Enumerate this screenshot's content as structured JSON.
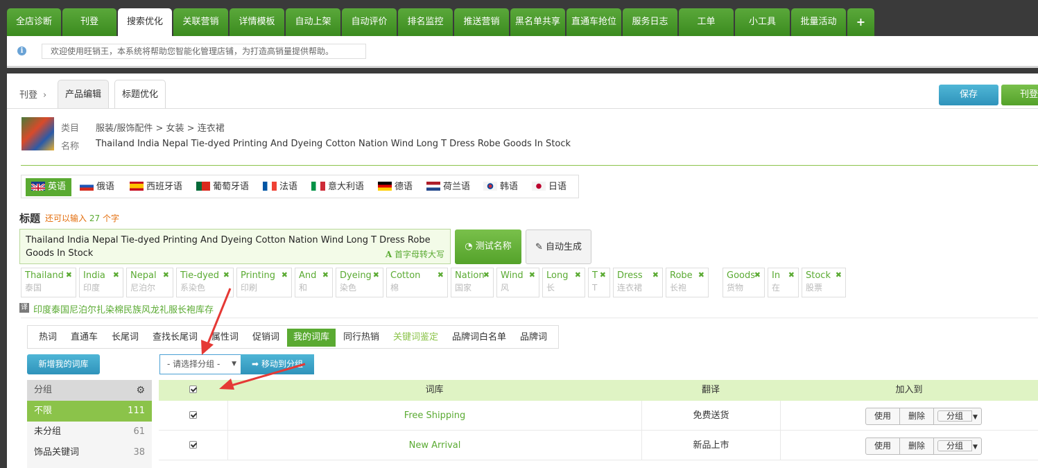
{
  "top_nav": {
    "tabs": [
      "全店诊断",
      "刊登",
      "搜索优化",
      "关联营销",
      "详情模板",
      "自动上架",
      "自动评价",
      "排名监控",
      "推送营销",
      "黑名单共享",
      "直通车抢位",
      "服务日志",
      "工单",
      "小工具",
      "批量活动",
      "+"
    ],
    "active": "搜索优化"
  },
  "notice": {
    "text": "欢迎使用旺销王，本系统将帮助您智能化管理店铺，为打造高销量提供帮助。"
  },
  "breadcrumb": {
    "root": "刊登",
    "chevron": "›"
  },
  "sub_tabs": {
    "edit": "产品编辑",
    "title_opt": "标题优化"
  },
  "actions": {
    "save": "保存",
    "publish": "刊登"
  },
  "product": {
    "category_label": "类目",
    "category_value": "服装/服饰配件 > 女装 > 连衣裙",
    "name_label": "名称",
    "name_value": "Thailand India Nepal Tie-dyed Printing And Dyeing Cotton Nation Wind Long T Dress Robe Goods In Stock"
  },
  "languages": [
    {
      "label": "英语",
      "flag": "uk-flag-icon",
      "active": true
    },
    {
      "label": "俄语",
      "flag": "russia-flag-icon"
    },
    {
      "label": "西班牙语",
      "flag": "spain-flag-icon"
    },
    {
      "label": "葡萄牙语",
      "flag": "portugal-flag-icon"
    },
    {
      "label": "法语",
      "flag": "france-flag-icon"
    },
    {
      "label": "意大利语",
      "flag": "italy-flag-icon"
    },
    {
      "label": "德语",
      "flag": "germany-flag-icon"
    },
    {
      "label": "荷兰语",
      "flag": "netherlands-flag-icon"
    },
    {
      "label": "韩语",
      "flag": "korea-flag-icon"
    },
    {
      "label": "日语",
      "flag": "japan-flag-icon"
    }
  ],
  "title_section": {
    "label": "标题",
    "remaining_prefix": "还可以输入",
    "remaining_count": "27",
    "remaining_suffix": "个字",
    "value": "Thailand India Nepal Tie-dyed Printing And Dyeing Cotton Nation Wind Long T Dress Robe Goods In Stock",
    "capitalize_label": "首字母转大写",
    "capitalize_icon": "A",
    "test_button": "测试名称",
    "auto_button": "自动生成"
  },
  "words": [
    {
      "en": "Thailand",
      "zh": "泰国"
    },
    {
      "en": "India",
      "zh": "印度"
    },
    {
      "en": "Nepal",
      "zh": "尼泊尔"
    },
    {
      "en": "Tie-dyed",
      "zh": "系染色"
    },
    {
      "en": "Printing",
      "zh": "印刷"
    },
    {
      "en": "And",
      "zh": "和"
    },
    {
      "en": "Dyeing",
      "zh": "染色"
    },
    {
      "en": "Cotton",
      "zh": "棉"
    },
    {
      "en": "Nation",
      "zh": "国家"
    },
    {
      "en": "Wind",
      "zh": "风"
    },
    {
      "en": "Long",
      "zh": "长"
    },
    {
      "en": "T",
      "zh": "T"
    },
    {
      "en": "Dress",
      "zh": "连衣裙"
    },
    {
      "en": "Robe",
      "zh": "长袍"
    },
    {
      "en": "Goods",
      "zh": "货物"
    },
    {
      "en": "In",
      "zh": "在"
    },
    {
      "en": "Stock",
      "zh": "股票"
    }
  ],
  "translation": {
    "icon": "译",
    "text": "印度泰国尼泊尔扎染棉民族风龙礼服长袍库存"
  },
  "keyword_tabs": [
    "热词",
    "直通车",
    "长尾词",
    "查找长尾词",
    "属性词",
    "促销词",
    "我的词库",
    "同行热销",
    "关键词鉴定",
    "品牌词白名单",
    "品牌词"
  ],
  "keyword_active": "我的词库",
  "library": {
    "new_button": "新增我的词库",
    "select_placeholder": "- 请选择分组 -",
    "move_button": "移动到分组"
  },
  "groups": {
    "header": "分组",
    "items": [
      {
        "name": "不限",
        "count": "111",
        "active": true
      },
      {
        "name": "未分组",
        "count": "61"
      },
      {
        "name": "饰品关键词",
        "count": "38"
      }
    ]
  },
  "table": {
    "headers": {
      "lib": "词库",
      "trans": "翻译",
      "add": "加入到"
    },
    "rows": [
      {
        "keyword": "Free Shipping",
        "translation": "免费送货"
      },
      {
        "keyword": "New Arrival",
        "translation": "新品上市"
      }
    ],
    "row_actions": {
      "use": "使用",
      "delete": "删除",
      "group": "分组"
    }
  },
  "colors": {
    "green": "#5aaa32",
    "blue": "#2f93bb",
    "arrow": "#e53935",
    "header_bg": "#dff3c4"
  }
}
